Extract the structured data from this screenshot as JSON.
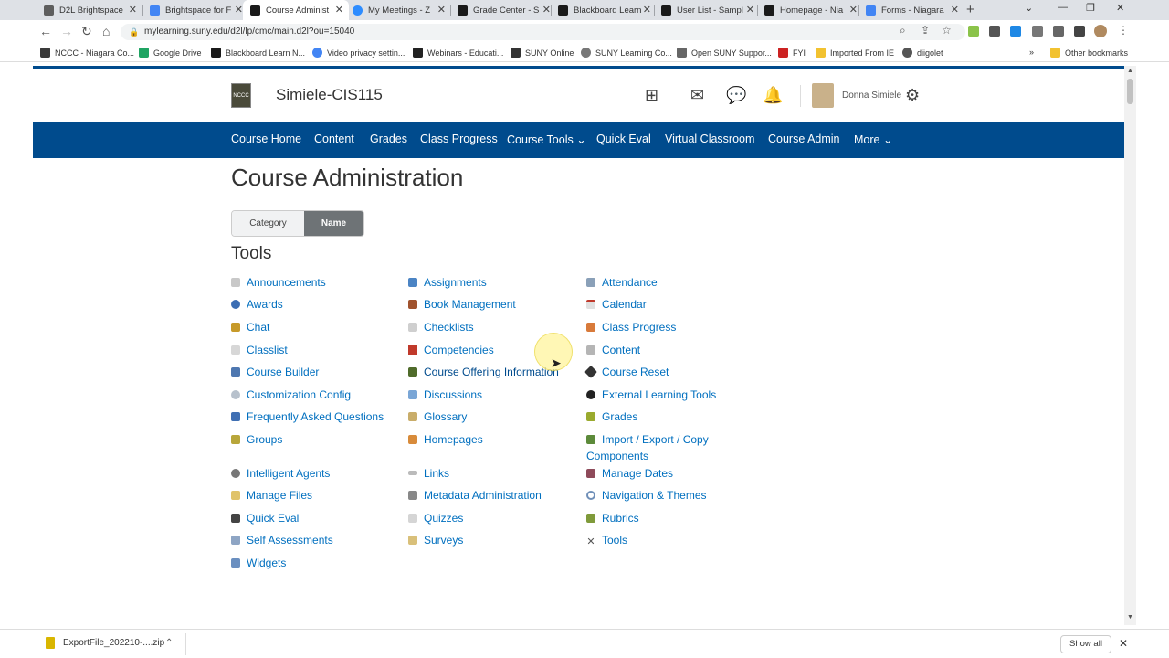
{
  "browser": {
    "tabs": [
      {
        "label": "D2L Brightspace",
        "color": "#5e5e5e"
      },
      {
        "label": "Brightspace for F",
        "color": "#4285f4"
      },
      {
        "label": "Course Administ",
        "color": "#1a1a1a",
        "active": true
      },
      {
        "label": "My Meetings - Z",
        "color": "#2d8cff"
      },
      {
        "label": "Grade Center - S",
        "color": "#1a1a1a"
      },
      {
        "label": "Blackboard Learn",
        "color": "#1a1a1a"
      },
      {
        "label": "User List - Sampl",
        "color": "#1a1a1a"
      },
      {
        "label": "Homepage - Nia",
        "color": "#1a1a1a"
      },
      {
        "label": "Forms - Niagara",
        "color": "#4285f4"
      }
    ],
    "url": "mylearning.suny.edu/d2l/lp/cmc/main.d2l?ou=15040",
    "bookmarks": [
      {
        "label": "NCCC - Niagara Co...",
        "color": "#3a3a3a"
      },
      {
        "label": "Google Drive",
        "color": "#1fa463"
      },
      {
        "label": "Blackboard Learn N...",
        "color": "#1a1a1a"
      },
      {
        "label": "Video privacy settin...",
        "color": "#4285f4"
      },
      {
        "label": "Webinars - Educati...",
        "color": "#222"
      },
      {
        "label": "SUNY Online",
        "color": "#333"
      },
      {
        "label": "SUNY Learning Co...",
        "color": "#777"
      },
      {
        "label": "Open SUNY Suppor...",
        "color": "#666"
      },
      {
        "label": "FYI",
        "color": "#cc2222"
      },
      {
        "label": "Imported From IE",
        "color": "#f2c230"
      },
      {
        "label": "diigolet",
        "color": "#555"
      }
    ],
    "other_bookmarks": "Other bookmarks"
  },
  "header": {
    "logo_text": "NCCC",
    "course_title": "Simiele-CIS115",
    "username": "Donna Simiele"
  },
  "navbar": {
    "items": [
      "Course Home",
      "Content",
      "Grades",
      "Class Progress",
      "Course Tools ⌄",
      "Quick Eval",
      "Virtual Classroom",
      "Course Admin",
      "More ⌄"
    ]
  },
  "main": {
    "title": "Course Administration",
    "toggle": {
      "category": "Category",
      "name": "Name"
    },
    "section_title": "Tools",
    "tools": {
      "col1": [
        "Announcements",
        "Awards",
        "Chat",
        "Classlist",
        "Course Builder",
        "Customization Config",
        "Frequently Asked Questions",
        "Groups",
        "Intelligent Agents",
        "Manage Files",
        "Quick Eval",
        "Self Assessments",
        "Widgets"
      ],
      "col2": [
        "Assignments",
        "Book Management",
        "Checklists",
        "Competencies",
        "Course Offering Information",
        "Discussions",
        "Glossary",
        "Homepages",
        "Links",
        "Metadata Administration",
        "Quizzes",
        "Surveys"
      ],
      "col3": [
        "Attendance",
        "Calendar",
        "Class Progress",
        "Content",
        "Course Reset",
        "External Learning Tools",
        "Grades",
        "Import / Export / Copy Components",
        "Manage Dates",
        "Navigation & Themes",
        "Rubrics",
        "Tools"
      ]
    },
    "hovered_tool": "Course Offering Information"
  },
  "downloads": {
    "file": "ExportFile_202210-....zip",
    "show_all": "Show all"
  },
  "colors": {
    "navbar": "#004b8d",
    "link": "#006fbf"
  }
}
